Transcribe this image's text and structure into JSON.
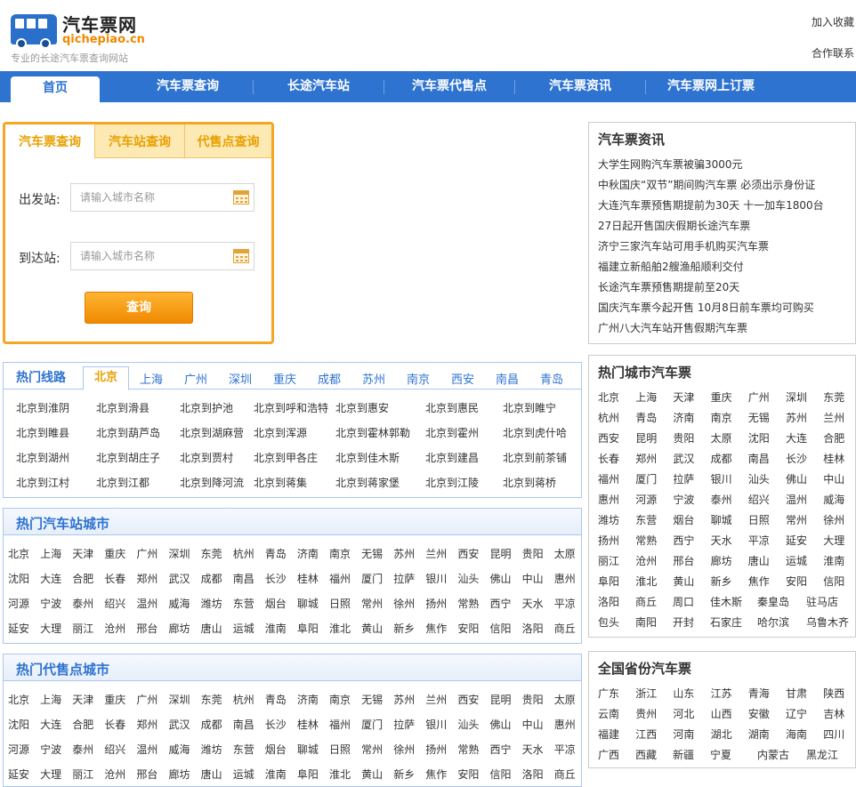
{
  "header": {
    "site_name": "汽车票网",
    "site_url": "qichepiao.cn",
    "slogan": "专业的长途汽车票查询网站",
    "link_favorite": "加入收藏",
    "link_contact": "合作联系"
  },
  "nav": {
    "items": [
      "首页",
      "汽车票查询",
      "长途汽车站",
      "汽车票代售点",
      "汽车票资讯",
      "汽车票网上订票"
    ],
    "active": "首页"
  },
  "query": {
    "tabs": [
      "汽车票查询",
      "汽车站查询",
      "代售点查询"
    ],
    "from_label": "出发站:",
    "to_label": "到达站:",
    "from_placeholder": "请输入城市名称",
    "to_placeholder": "请输入城市名称",
    "submit": "查询"
  },
  "routes": {
    "title": "热门线路",
    "tabs": [
      "北京",
      "上海",
      "广州",
      "深圳",
      "重庆",
      "成都",
      "苏州",
      "南京",
      "西安",
      "南昌",
      "青岛"
    ],
    "rows": [
      [
        "北京到淮阴",
        "北京到滑县",
        "北京到护池",
        "北京到呼和浩特",
        "北京到惠安",
        "北京到惠民",
        "北京到睢宁"
      ],
      [
        "北京到睢县",
        "北京到葫芦岛",
        "北京到湖麻营",
        "北京到浑源",
        "北京到霍林郭勒",
        "北京到霍州",
        "北京到虎什哈"
      ],
      [
        "北京到湖州",
        "北京到胡庄子",
        "北京到贾村",
        "北京到甲各庄",
        "北京到佳木斯",
        "北京到建昌",
        "北京到前茶铺"
      ],
      [
        "北京到江村",
        "北京到江都",
        "北京到降河流",
        "北京到蒋集",
        "北京到蒋家堡",
        "北京到江陵",
        "北京到蒋桥"
      ]
    ]
  },
  "station_cities": {
    "title": "热门汽车站城市",
    "rows": [
      [
        "北京",
        "上海",
        "天津",
        "重庆",
        "广州",
        "深圳",
        "东莞",
        "杭州",
        "青岛",
        "济南",
        "南京",
        "无锡",
        "苏州",
        "兰州",
        "西安",
        "昆明",
        "贵阳",
        "太原"
      ],
      [
        "沈阳",
        "大连",
        "合肥",
        "长春",
        "郑州",
        "武汉",
        "成都",
        "南昌",
        "长沙",
        "桂林",
        "福州",
        "厦门",
        "拉萨",
        "银川",
        "汕头",
        "佛山",
        "中山",
        "惠州"
      ],
      [
        "河源",
        "宁波",
        "泰州",
        "绍兴",
        "温州",
        "威海",
        "潍坊",
        "东营",
        "烟台",
        "聊城",
        "日照",
        "常州",
        "徐州",
        "扬州",
        "常熟",
        "西宁",
        "天水",
        "平凉"
      ],
      [
        "延安",
        "大理",
        "丽江",
        "沧州",
        "邢台",
        "廊坊",
        "唐山",
        "运城",
        "淮南",
        "阜阳",
        "淮北",
        "黄山",
        "新乡",
        "焦作",
        "安阳",
        "信阳",
        "洛阳",
        "商丘"
      ]
    ]
  },
  "agent_cities": {
    "title": "热门代售点城市",
    "rows": [
      [
        "北京",
        "上海",
        "天津",
        "重庆",
        "广州",
        "深圳",
        "东莞",
        "杭州",
        "青岛",
        "济南",
        "南京",
        "无锡",
        "苏州",
        "兰州",
        "西安",
        "昆明",
        "贵阳",
        "太原"
      ],
      [
        "沈阳",
        "大连",
        "合肥",
        "长春",
        "郑州",
        "武汉",
        "成都",
        "南昌",
        "长沙",
        "桂林",
        "福州",
        "厦门",
        "拉萨",
        "银川",
        "汕头",
        "佛山",
        "中山",
        "惠州"
      ],
      [
        "河源",
        "宁波",
        "泰州",
        "绍兴",
        "温州",
        "威海",
        "潍坊",
        "东营",
        "烟台",
        "聊城",
        "日照",
        "常州",
        "徐州",
        "扬州",
        "常熟",
        "西宁",
        "天水",
        "平凉"
      ],
      [
        "延安",
        "大理",
        "丽江",
        "沧州",
        "邢台",
        "廊坊",
        "唐山",
        "运城",
        "淮南",
        "阜阳",
        "淮北",
        "黄山",
        "新乡",
        "焦作",
        "安阳",
        "信阳",
        "洛阳",
        "商丘"
      ]
    ]
  },
  "news": {
    "title": "汽车票资讯",
    "items": [
      "大学生网购汽车票被骗3000元",
      "中秋国庆“双节”期间购汽车票 必须出示身份证",
      "大连汽车票预售期提前为30天 十一加车1800台",
      "27日起开售国庆假期长途汽车票",
      "济宁三家汽车站可用手机购买汽车票",
      "福建立新船舶2艘渔船顺利交付",
      "长途汽车票预售期提前至20天",
      "国庆汽车票今起开售 10月8日前车票均可购买",
      "广州八大汽车站开售假期汽车票"
    ]
  },
  "hot_city_tickets": {
    "title": "热门城市汽车票",
    "rows": [
      [
        "北京",
        "上海",
        "天津",
        "重庆",
        "广州",
        "深圳",
        "东莞"
      ],
      [
        "杭州",
        "青岛",
        "济南",
        "南京",
        "无锡",
        "苏州",
        "兰州"
      ],
      [
        "西安",
        "昆明",
        "贵阳",
        "太原",
        "沈阳",
        "大连",
        "合肥"
      ],
      [
        "长春",
        "郑州",
        "武汉",
        "成都",
        "南昌",
        "长沙",
        "桂林"
      ],
      [
        "福州",
        "厦门",
        "拉萨",
        "银川",
        "汕头",
        "佛山",
        "中山"
      ],
      [
        "惠州",
        "河源",
        "宁波",
        "泰州",
        "绍兴",
        "温州",
        "威海"
      ],
      [
        "潍坊",
        "东营",
        "烟台",
        "聊城",
        "日照",
        "常州",
        "徐州"
      ],
      [
        "扬州",
        "常熟",
        "西宁",
        "天水",
        "平凉",
        "延安",
        "大理"
      ],
      [
        "丽江",
        "沧州",
        "邢台",
        "廊坊",
        "唐山",
        "运城",
        "淮南"
      ],
      [
        "阜阳",
        "淮北",
        "黄山",
        "新乡",
        "焦作",
        "安阳",
        "信阳"
      ],
      [
        "洛阳",
        "商丘",
        "周口",
        "佳木斯",
        "秦皇岛",
        "驻马店"
      ],
      [
        "包头",
        "南阳",
        "开封",
        "石家庄",
        "哈尔滨",
        "乌鲁木齐"
      ]
    ]
  },
  "province_tickets": {
    "title": "全国省份汽车票",
    "rows": [
      [
        "广东",
        "浙江",
        "山东",
        "江苏",
        "青海",
        "甘肃",
        "陕西"
      ],
      [
        "云南",
        "贵州",
        "河北",
        "山西",
        "安徽",
        "辽宁",
        "吉林"
      ],
      [
        "福建",
        "江西",
        "河南",
        "湖北",
        "湖南",
        "海南",
        "四川"
      ],
      [
        "广西",
        "西藏",
        "新疆",
        "宁夏",
        "内蒙古",
        "黑龙江"
      ]
    ]
  },
  "colors": {
    "brand_blue": "#2e73d0",
    "accent_orange": "#f5a623"
  }
}
